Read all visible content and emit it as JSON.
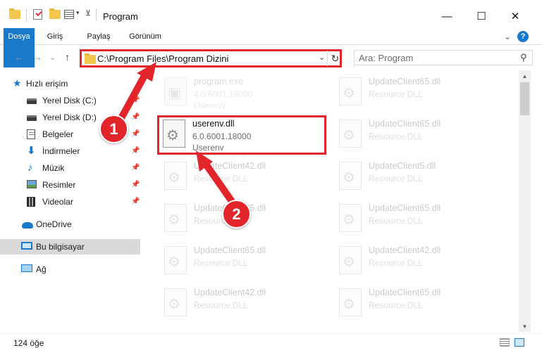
{
  "window": {
    "title": "Program",
    "minimize_glyph": "—",
    "maximize_glyph": "☐",
    "close_glyph": "✕"
  },
  "ribbon": {
    "tabs": [
      "Dosya",
      "Giriş",
      "Paylaş",
      "Görünüm"
    ],
    "expand_glyph": "⌄",
    "help_glyph": "?"
  },
  "nav": {
    "back_glyph": "←",
    "forward_glyph": "→",
    "recent_glyph": "⌄",
    "up_glyph": "↑"
  },
  "address": {
    "path": "C:\\Program Files\\Program Dizini",
    "dropdown_glyph": "⌄",
    "refresh_glyph": "↻"
  },
  "search": {
    "placeholder": "Ara: Program",
    "icon": "search-icon",
    "icon_glyph": "⚲"
  },
  "sidebar": {
    "items": [
      {
        "label": "Hızlı erişim",
        "icon": "star-icon"
      },
      {
        "label": "Yerel Disk (C:)",
        "icon": "disk-icon",
        "pin": "📌"
      },
      {
        "label": "Yerel Disk (D:)",
        "icon": "disk-icon",
        "pin": "📌"
      },
      {
        "label": "Belgeler",
        "icon": "documents-icon",
        "pin": "📌"
      },
      {
        "label": "İndirmeler",
        "icon": "downloads-icon",
        "pin": "📌"
      },
      {
        "label": "Müzik",
        "icon": "music-icon",
        "pin": "📌"
      },
      {
        "label": "Resimler",
        "icon": "pictures-icon",
        "pin": "📌"
      },
      {
        "label": "Videolar",
        "icon": "videos-icon",
        "pin": "📌"
      },
      {
        "label": "OneDrive",
        "icon": "cloud-icon"
      },
      {
        "label": "Bu bilgisayar",
        "icon": "computer-icon"
      },
      {
        "label": "Ağ",
        "icon": "network-icon"
      }
    ]
  },
  "files": [
    {
      "name": "program.exe",
      "line2": "4.0.6001.18000",
      "line3": "Userenv"
    },
    {
      "name": "UpdateClient65.dll",
      "line2": "Resource DLL"
    },
    {
      "name": "userenv.dll",
      "line2": "6.0.6001.18000",
      "line3": "Userenv"
    },
    {
      "name": "UpdateClient65.dll",
      "line2": "Resource DLL"
    },
    {
      "name": "UpdateClient42.dll",
      "line2": "Resource DLL"
    },
    {
      "name": "UpdateClient5.dll",
      "line2": "Resource DLL"
    },
    {
      "name": "UpdateClient65.dll",
      "line2": "Resource DLL"
    },
    {
      "name": "UpdateClient65.dll",
      "line2": "Resource DLL"
    },
    {
      "name": "UpdateClient65.dll",
      "line2": "Resource DLL"
    },
    {
      "name": "UpdateClient42.dll",
      "line2": "Resource DLL"
    },
    {
      "name": "UpdateClient42.dll",
      "line2": "Resource DLL"
    },
    {
      "name": "UpdateClient65.dll",
      "line2": "Resource DLL"
    }
  ],
  "scrollbar": {
    "up_glyph": "▲",
    "down_glyph": "▼"
  },
  "status": {
    "count": "124 öğe"
  },
  "callouts": [
    "1",
    "2"
  ],
  "colors": {
    "accent": "#1979ca",
    "highlight": "#e1252b"
  }
}
